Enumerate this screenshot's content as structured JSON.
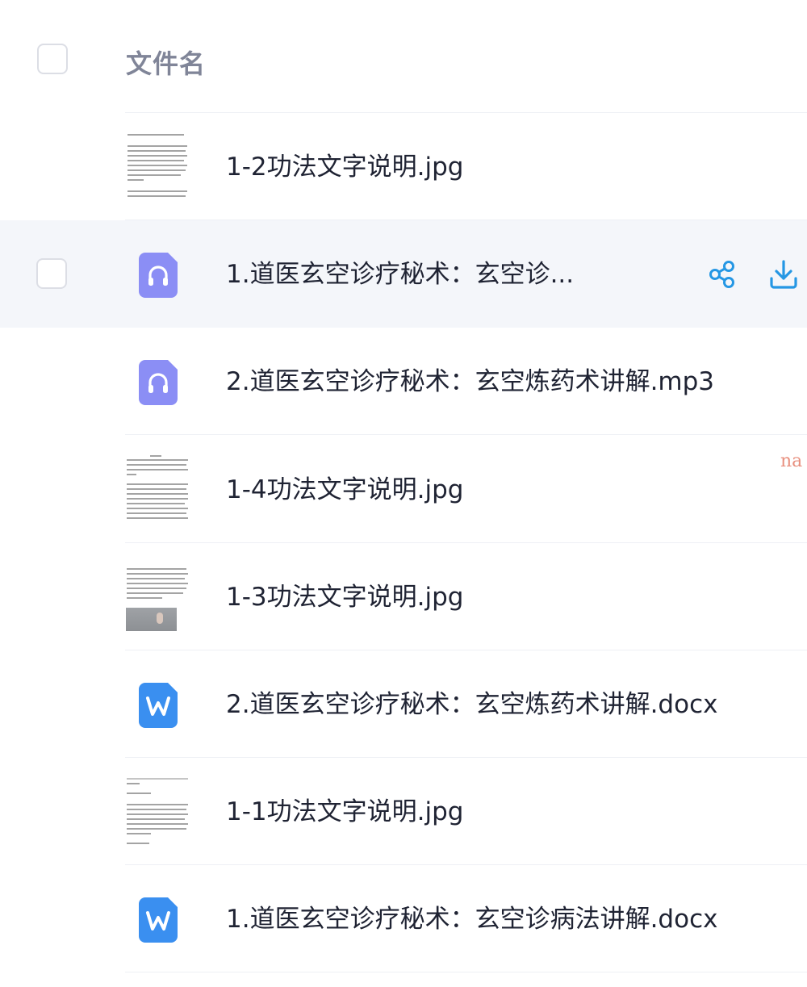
{
  "header": {
    "column_title": "文件名"
  },
  "rows": [
    {
      "name": "1-2功法文字说明.jpg",
      "kind": "image-thumbnail"
    },
    {
      "name": "1.道医玄空诊疗秘术：玄空诊...",
      "kind": "audio-icon",
      "hovered": true,
      "actions": [
        "share-icon",
        "download-icon"
      ]
    },
    {
      "name": "2.道医玄空诊疗秘术：玄空炼药术讲解.mp3",
      "kind": "audio-icon"
    },
    {
      "name": "1-4功法文字说明.jpg",
      "kind": "image-thumbnail"
    },
    {
      "name": "1-3功法文字说明.jpg",
      "kind": "image-thumbnail"
    },
    {
      "name": "2.道医玄空诊疗秘术：玄空炼药术讲解.docx",
      "kind": "word-icon"
    },
    {
      "name": "1-1功法文字说明.jpg",
      "kind": "image-thumbnail"
    },
    {
      "name": "1.道医玄空诊疗秘术：玄空诊病法讲解.docx",
      "kind": "word-icon"
    }
  ],
  "watermark": "na",
  "colors": {
    "accent": "#2597e4",
    "audio_icon": "#8b8ef5",
    "word_icon": "#3a8ff0",
    "hover_row": "#f4f6fa",
    "header_text": "#808598",
    "watermark": "#e8907f"
  }
}
